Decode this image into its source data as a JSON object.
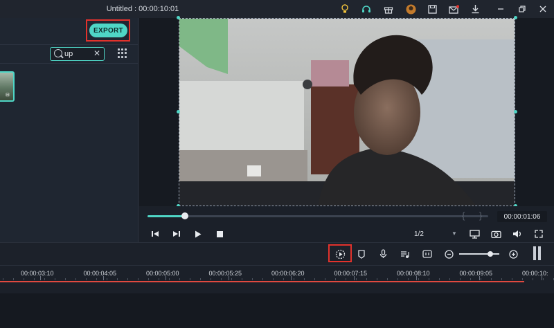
{
  "window": {
    "title": "Untitled : 00:00:10:01",
    "icons": [
      "lightbulb-icon",
      "headset-icon",
      "gift-icon",
      "avatar-icon",
      "save-icon",
      "mail-icon",
      "download-icon",
      "minimize-icon",
      "maximize-icon",
      "close-icon"
    ]
  },
  "media_panel": {
    "export_label": "EXPORT",
    "search": {
      "value": "up",
      "placeholder": ""
    }
  },
  "preview": {
    "timecode": "00:00:01:06",
    "progress_fraction": 0.11,
    "quality": "1/2"
  },
  "timeline": {
    "zoom_fraction": 0.78,
    "ruler_labels": [
      "00:00:03:10",
      "00:00:04:05",
      "00:00:05:00",
      "00:00:05:25",
      "00:00:06:20",
      "00:00:07:15",
      "00:00:08:10",
      "00:00:09:05",
      "00:00:10:"
    ]
  },
  "colors": {
    "accent": "#4fd6c6",
    "highlight_box": "#e2322c",
    "playhead": "#e0493f"
  }
}
